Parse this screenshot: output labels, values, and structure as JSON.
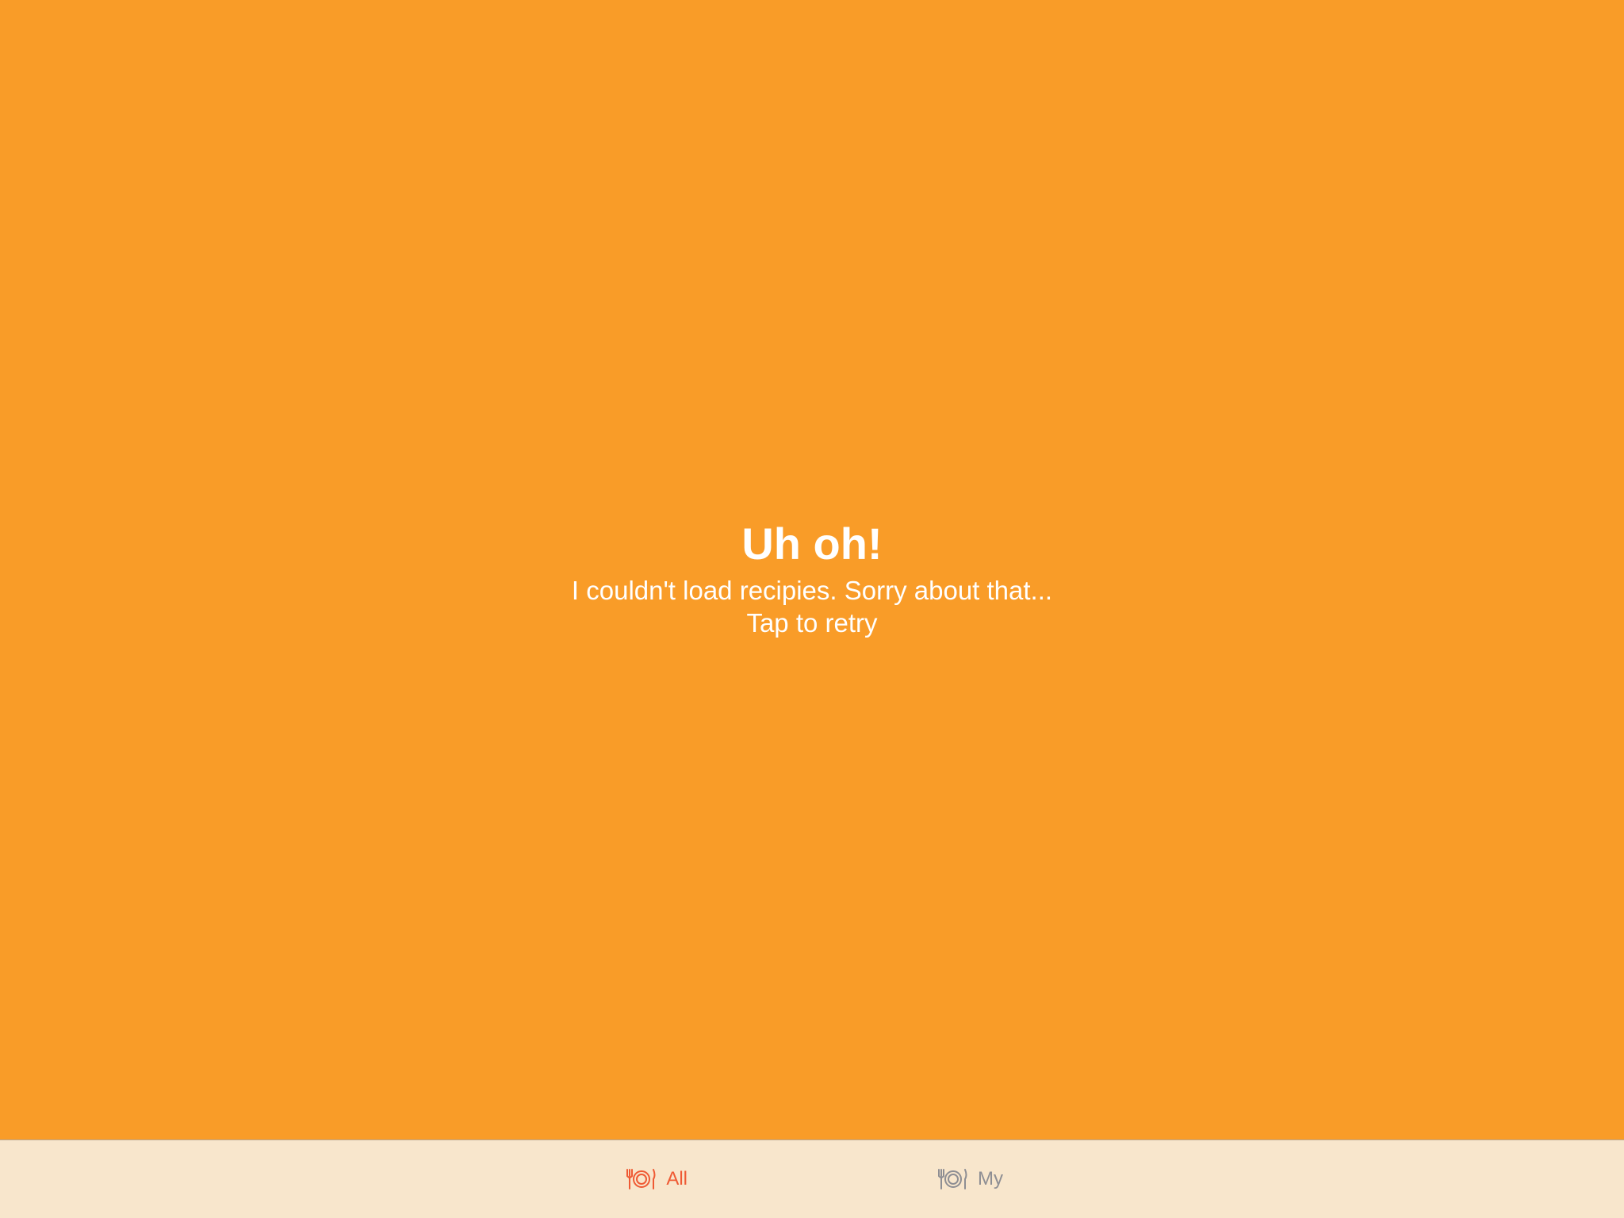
{
  "error": {
    "title": "Uh oh!",
    "message": "I couldn't load recipies. Sorry about that...",
    "retry": "Tap to retry"
  },
  "tabs": [
    {
      "label": "All",
      "icon": "plate-cutlery-icon",
      "selected": true
    },
    {
      "label": "My",
      "icon": "plate-cutlery-icon",
      "selected": false
    }
  ],
  "colors": {
    "background": "#f99c28",
    "tab_bar": "#f8e6cc",
    "tab_selected": "#ef5a34",
    "tab_inactive": "#8e8e93"
  }
}
